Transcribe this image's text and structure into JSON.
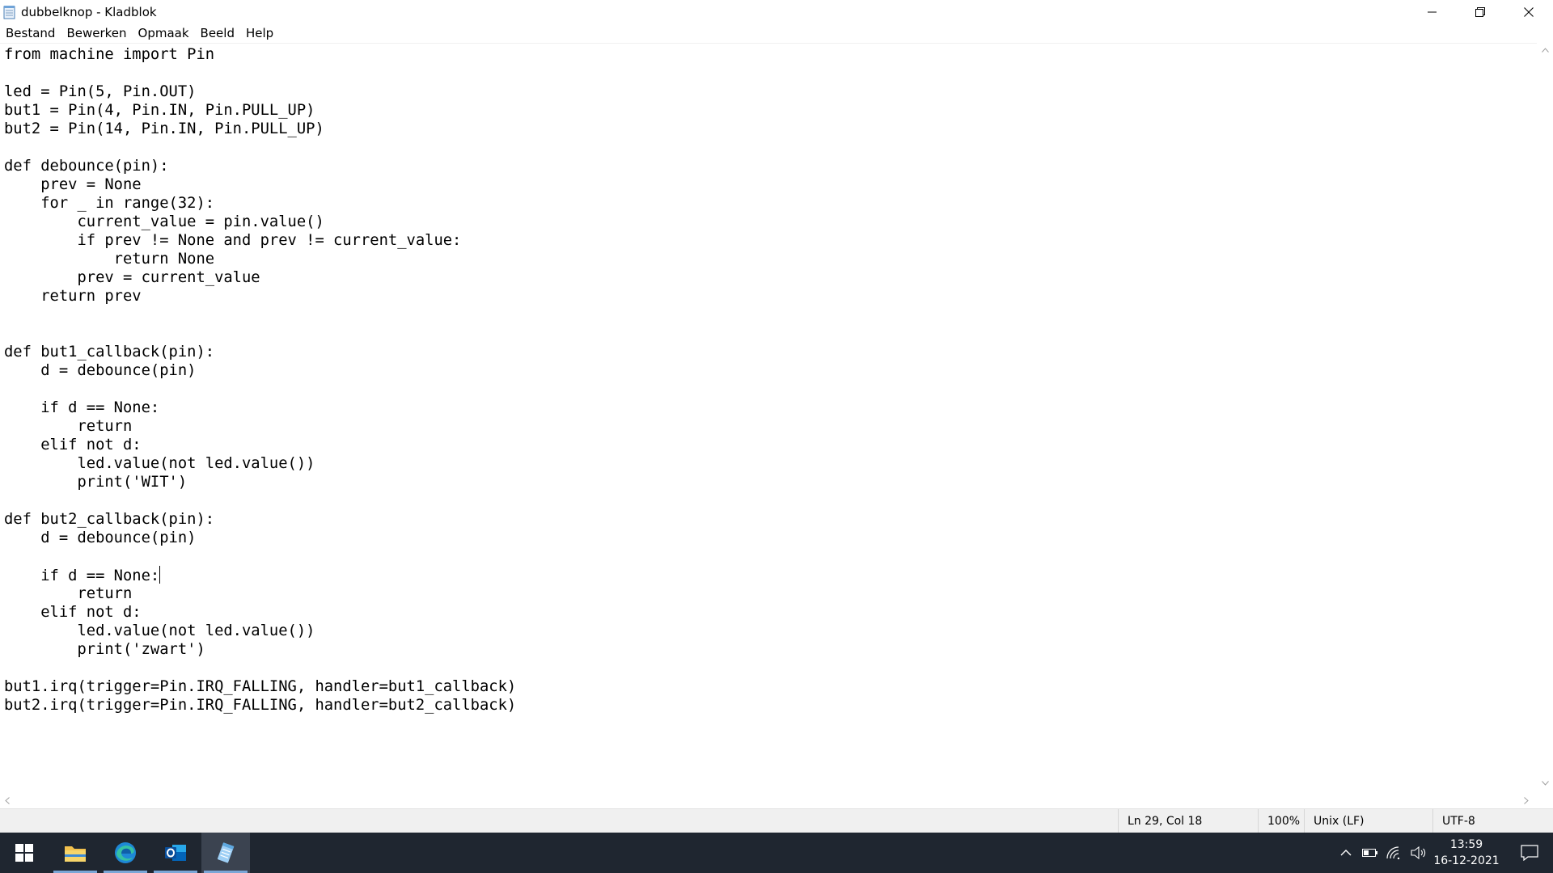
{
  "window": {
    "title": "dubbelknop - Kladblok",
    "controls": {
      "minimize": "minimize",
      "maximize": "restore",
      "close": "close"
    }
  },
  "menu": [
    "Bestand",
    "Bewerken",
    "Opmaak",
    "Beeld",
    "Help"
  ],
  "editor": {
    "lines": [
      "from machine import Pin",
      "",
      "led = Pin(5, Pin.OUT)",
      "but1 = Pin(4, Pin.IN, Pin.PULL_UP)",
      "but2 = Pin(14, Pin.IN, Pin.PULL_UP)",
      "",
      "def debounce(pin):",
      "    prev = None",
      "    for _ in range(32):",
      "        current_value = pin.value()",
      "        if prev != None and prev != current_value:",
      "            return None",
      "        prev = current_value",
      "    return prev",
      "",
      "",
      "def but1_callback(pin):",
      "    d = debounce(pin)",
      "",
      "    if d == None:",
      "        return",
      "    elif not d:",
      "        led.value(not led.value())",
      "        print('WIT')",
      "",
      "def but2_callback(pin):",
      "    d = debounce(pin)",
      "",
      "    if d == None:",
      "        return",
      "    elif not d:",
      "        led.value(not led.value())",
      "        print('zwart')",
      "",
      "but1.irq(trigger=Pin.IRQ_FALLING, handler=but1_callback)",
      "but2.irq(trigger=Pin.IRQ_FALLING, handler=but2_callback)"
    ],
    "caret_line": 29
  },
  "status": {
    "position": "Ln 29, Col 18",
    "zoom": "100%",
    "line_ending": "Unix (LF)",
    "encoding": "UTF-8"
  },
  "taskbar": {
    "apps": [
      "start-icon",
      "file-explorer-icon",
      "edge-icon",
      "outlook-icon",
      "notepad-icon"
    ],
    "active_app": "notepad-icon",
    "pinned_running": [
      "file-explorer-icon",
      "edge-icon",
      "outlook-icon",
      "notepad-icon"
    ],
    "tray": [
      "chevron-up-icon",
      "battery-icon",
      "wifi-icon",
      "volume-icon"
    ],
    "clock": {
      "time": "13:59",
      "date": "16-12-2021"
    },
    "notifications": "notification-icon"
  },
  "colors": {
    "taskbar_bg": "#1f2630",
    "status_bg": "#f0f0f0",
    "accent": "#7aa6d6"
  }
}
